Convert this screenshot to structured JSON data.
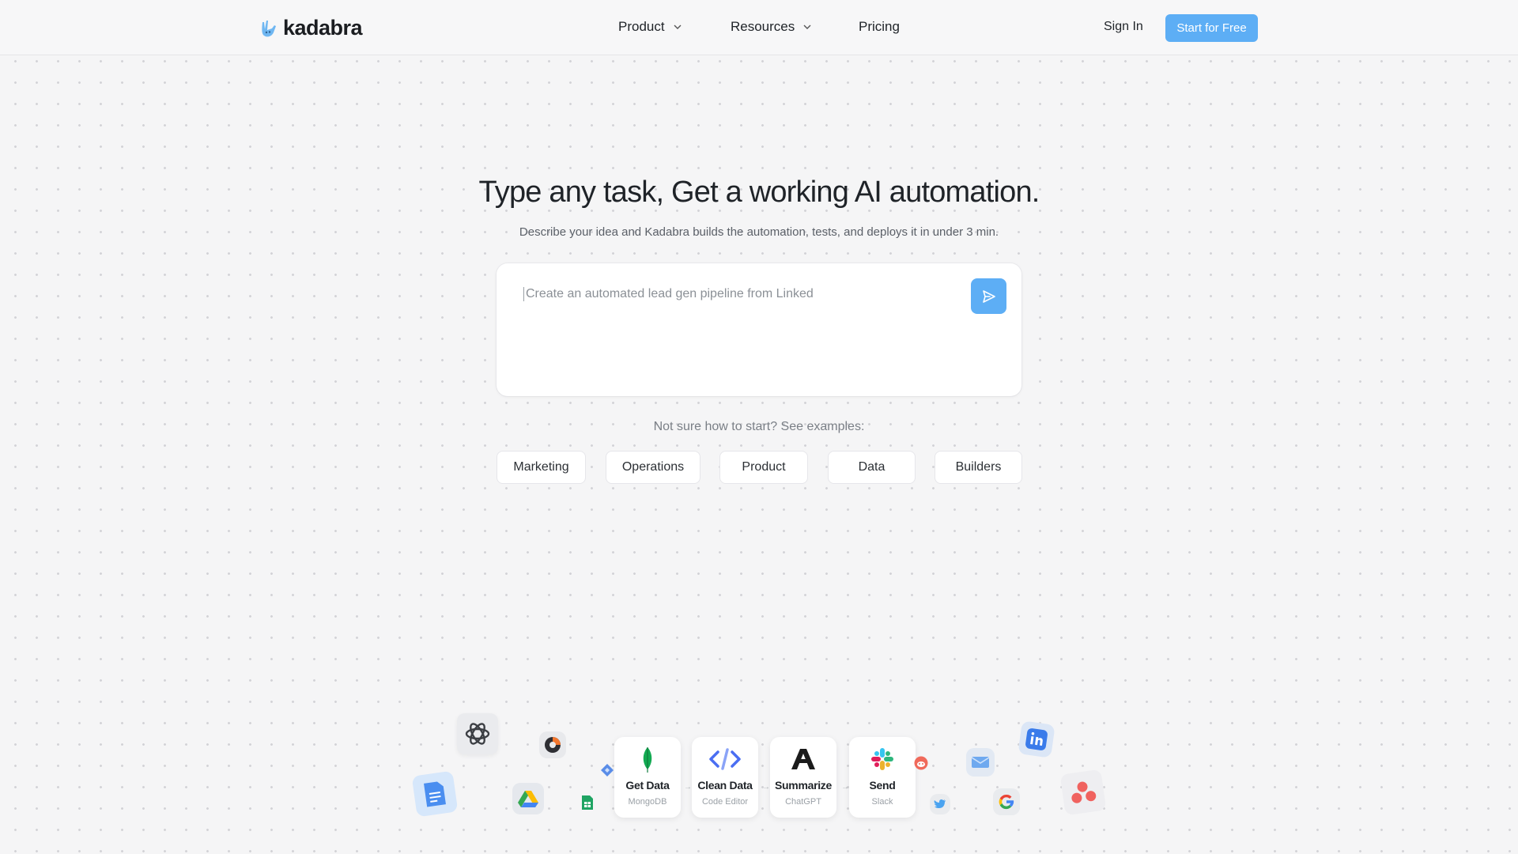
{
  "brand": {
    "name": "kadabra",
    "accent": "#5daef5"
  },
  "nav": {
    "links": [
      {
        "label": "Product",
        "has_dropdown": true
      },
      {
        "label": "Resources",
        "has_dropdown": true
      },
      {
        "label": "Pricing",
        "has_dropdown": false
      }
    ],
    "signin_label": "Sign In",
    "cta_label": "Start for Free"
  },
  "hero": {
    "title": "Type any task, Get a working AI automation.",
    "subtitle": "Describe your idea and Kadabra builds the automation, tests, and deploys it in under 3 min."
  },
  "prompt": {
    "value": "Create an automated lead gen pipeline from Linked",
    "send_icon": "send-icon"
  },
  "examples": {
    "label": "Not sure how to start? See examples:",
    "chips": [
      "Marketing",
      "Operations",
      "Product",
      "Data",
      "Builders"
    ]
  },
  "workflow": {
    "steps": [
      {
        "title": "Get Data",
        "subtitle": "MongoDB",
        "icon": "mongodb-icon"
      },
      {
        "title": "Clean Data",
        "subtitle": "Code Editor",
        "icon": "code-icon"
      },
      {
        "title": "Summarize",
        "subtitle": "ChatGPT",
        "icon": "anthropic-icon"
      },
      {
        "title": "Send",
        "subtitle": "Slack",
        "icon": "slack-icon"
      }
    ],
    "floating_icons": [
      "openai-icon",
      "docs-icon",
      "drive-icon",
      "sheets-icon",
      "clock-app-icon",
      "diamond-icon",
      "reddit-icon",
      "twitter-icon",
      "mail-icon",
      "google-icon",
      "linkedin-icon",
      "asana-icon"
    ]
  }
}
